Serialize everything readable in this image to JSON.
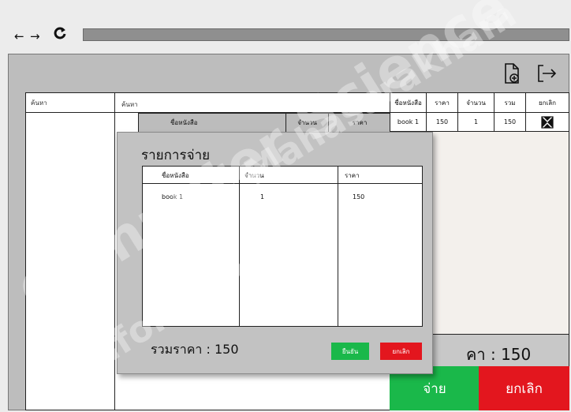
{
  "browser": {
    "back": "←",
    "forward": "→",
    "reload": "C"
  },
  "toolbar": {
    "new_doc_icon": "document-add-icon",
    "logout_icon": "logout-arrow-icon"
  },
  "left_panel": {
    "search_placeholder": "ค้นหา"
  },
  "center_panel": {
    "search_placeholder": "ค้นหา",
    "result_headers": {
      "book": "ชื่อหนังสือ",
      "qty": "จำนวน",
      "price": "ราคา"
    }
  },
  "order_table": {
    "headers": [
      "ชื่อหนังสือ",
      "ราคา",
      "จำนวน",
      "รวม",
      "ยกเลิก"
    ],
    "rows": [
      {
        "name": "book 1",
        "price": "150",
        "qty": "1",
        "sum": "150"
      }
    ]
  },
  "total": {
    "label": "ราคา :",
    "value": "150",
    "label_visible": "คา : 150"
  },
  "actions": {
    "pay": "จ่าย",
    "cancel": "ยกเลิก"
  },
  "modal": {
    "title": "รายการจ่าย",
    "headers": {
      "book": "ชื่อหนังสือ",
      "qty": "จำนวน",
      "price": "ราคา"
    },
    "row": {
      "book": "book 1",
      "qty": "1",
      "price": "150"
    },
    "total_text": "รวมราคา : 150",
    "confirm": "ยืนยัน",
    "cancel": "ยกเลิก"
  },
  "watermark": [
    "Computer Science",
    "Informatics",
    "Mahasarakham"
  ],
  "colors": {
    "green": "#1ab84a",
    "red": "#e3161e",
    "panel": "#bdbdbd"
  }
}
